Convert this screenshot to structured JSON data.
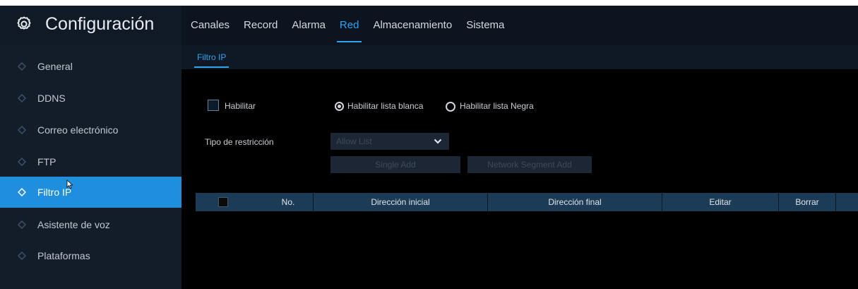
{
  "header": {
    "title": "Configuración",
    "gear_icon": "gear-icon",
    "tabs": [
      {
        "label": "Canales",
        "active": false
      },
      {
        "label": "Record",
        "active": false
      },
      {
        "label": "Alarma",
        "active": false
      },
      {
        "label": "Red",
        "active": true
      },
      {
        "label": "Almacenamiento",
        "active": false
      },
      {
        "label": "Sistema",
        "active": false
      }
    ]
  },
  "sidebar": {
    "items": [
      {
        "label": "General",
        "active": false
      },
      {
        "label": "DDNS",
        "active": false
      },
      {
        "label": "Correo electrónico",
        "active": false
      },
      {
        "label": "FTP",
        "active": false
      },
      {
        "label": "Filtro IP",
        "active": true
      },
      {
        "label": "Asistente de voz",
        "active": false
      },
      {
        "label": "Plataformas",
        "active": false
      }
    ]
  },
  "subtab": {
    "label": "Filtro IP"
  },
  "form": {
    "enable_label": "Habilitar",
    "enable_checked": false,
    "whitelist_label": "Habilitar lista blanca",
    "whitelist_selected": true,
    "blacklist_label": "Habilitar lista Negra",
    "blacklist_selected": false,
    "restriction_label": "Tipo de restricción",
    "restriction_value": "Allow List",
    "single_add_label": "Single Add",
    "segment_add_label": "Network Segment Add"
  },
  "table": {
    "columns": [
      "No.",
      "Dirección inicial",
      "Dirección final",
      "Editar",
      "Borrar"
    ],
    "rows": []
  },
  "colors": {
    "accent": "#2ea4f2",
    "sidebar_active": "#1f8fdd",
    "table_header": "#1c3b57"
  }
}
